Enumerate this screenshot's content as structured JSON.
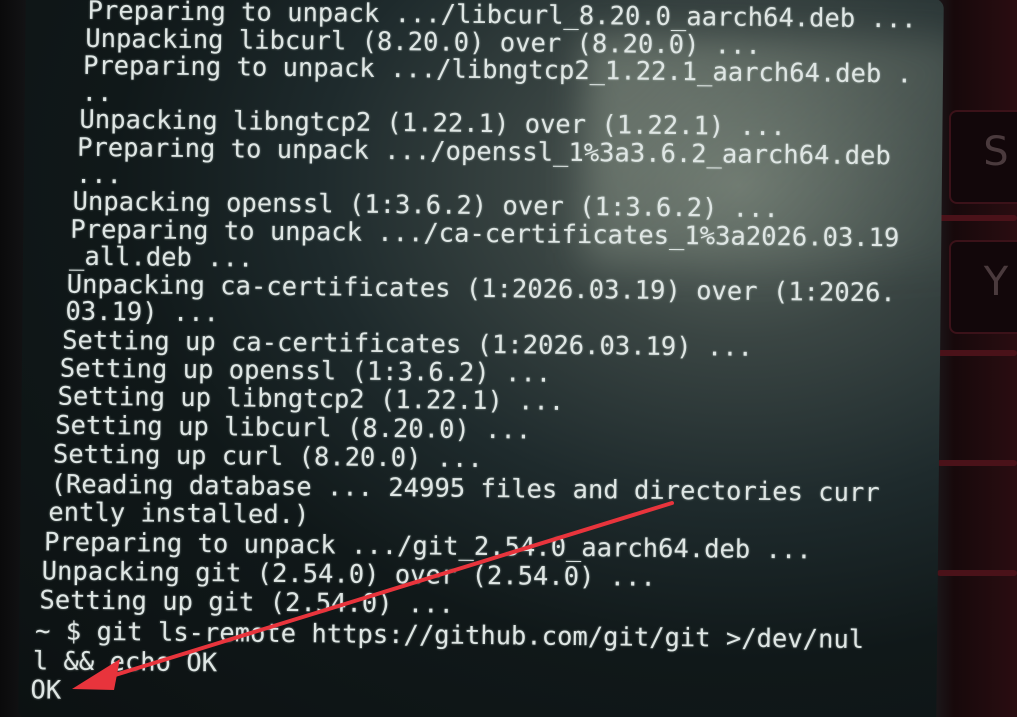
{
  "terminal": {
    "lines": [
      "Preparing to unpack .../libcurl_8.20.0_aarch64.deb ...",
      "Unpacking libcurl (8.20.0) over (8.20.0) ...",
      "Preparing to unpack .../libngtcp2_1.22.1_aarch64.deb .",
      "..",
      "Unpacking libngtcp2 (1.22.1) over (1.22.1) ...",
      "Preparing to unpack .../openssl_1%3a3.6.2_aarch64.deb",
      "...",
      "Unpacking openssl (1:3.6.2) over (1:3.6.2) ...",
      "Preparing to unpack .../ca-certificates_1%3a2026.03.19",
      "_all.deb ...",
      "Unpacking ca-certificates (1:2026.03.19) over (1:2026.",
      "03.19) ...",
      "Setting up ca-certificates (1:2026.03.19) ...",
      "Setting up openssl (1:3.6.2) ...",
      "Setting up libngtcp2 (1.22.1) ...",
      "Setting up libcurl (8.20.0) ...",
      "Setting up curl (8.20.0) ...",
      "(Reading database ... 24995 files and directories curr",
      "ently installed.)",
      "Preparing to unpack .../git_2.54.0_aarch64.deb ...",
      "Unpacking git (2.54.0) over (2.54.0) ...",
      "Setting up git (2.54.0) ...",
      "~ $ git ls-remote https://github.com/git/git >/dev/nul",
      "l && echo OK",
      "OK"
    ]
  },
  "background_keys": {
    "key_1": "S",
    "key_2": "Y"
  },
  "colors": {
    "annotation_arrow": "#e8343c",
    "terminal_text": "#dfe6e4"
  }
}
